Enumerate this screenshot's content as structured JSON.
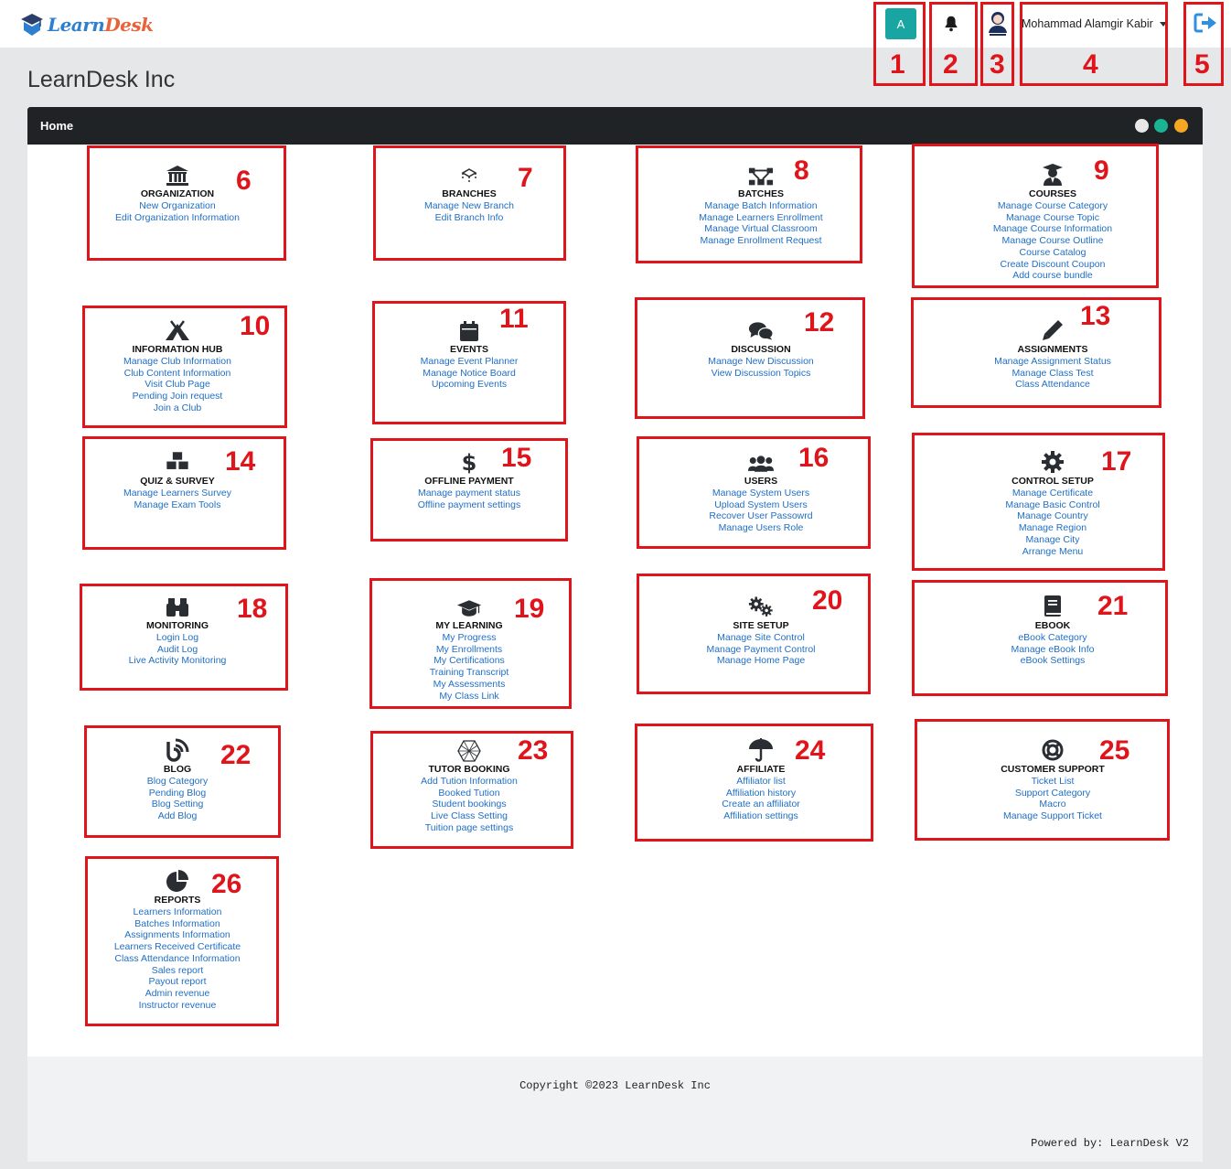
{
  "brand": {
    "name_part1": "Learn",
    "name_part2": "Desk"
  },
  "header": {
    "avatar_letter": "A",
    "user_name": "Mohammad Alamgir Kabir"
  },
  "org_title": "LearnDesk Inc",
  "panel": {
    "title": "Home"
  },
  "footer": {
    "copyright": "Copyright ©2023 LearnDesk Inc",
    "powered": "Powered by:  LearnDesk V2"
  },
  "annotation_numbers": [
    "1",
    "2",
    "3",
    "4",
    "5",
    "6",
    "7",
    "8",
    "9",
    "10",
    "11",
    "12",
    "13",
    "14",
    "15",
    "16",
    "17",
    "18",
    "19",
    "20",
    "21",
    "22",
    "23",
    "24",
    "25",
    "26"
  ],
  "annotation_color": "#e0151c",
  "link_color": "#1f6fc5",
  "cards": [
    {
      "id": "organization",
      "icon": "bank-icon",
      "title": "ORGANIZATION",
      "links": [
        "New Organization",
        "Edit Organization Information"
      ]
    },
    {
      "id": "branches",
      "icon": "branch-icon",
      "title": "BRANCHES",
      "links": [
        "Manage New Branch",
        "Edit Branch Info"
      ]
    },
    {
      "id": "batches",
      "icon": "network-icon",
      "title": "BATCHES",
      "links": [
        "Manage Batch Information",
        "Manage Learners Enrollment",
        "Manage Virtual Classroom",
        "Manage Enrollment Request"
      ]
    },
    {
      "id": "courses",
      "icon": "teacher-icon",
      "title": "COURSES",
      "links": [
        "Manage Course Category",
        "Manage Course Topic",
        "Manage Course Information",
        "Manage Course Outline",
        "Course Catalog",
        "Create Discount Coupon",
        "Add course bundle"
      ]
    },
    {
      "id": "information-hub",
      "icon": "campground-icon",
      "title": "INFORMATION HUB",
      "links": [
        "Manage Club Information",
        "Club Content Information",
        "Visit Club Page",
        "Pending Join request",
        "Join a Club"
      ]
    },
    {
      "id": "events",
      "icon": "calendar-icon",
      "title": "EVENTS",
      "links": [
        "Manage Event Planner",
        "Manage Notice Board",
        "Upcoming Events"
      ]
    },
    {
      "id": "discussion",
      "icon": "comments-icon",
      "title": "DISCUSSION",
      "links": [
        "Manage New Discussion",
        "View Discussion Topics"
      ]
    },
    {
      "id": "assignments",
      "icon": "pencil-icon",
      "title": "ASSIGNMENTS",
      "links": [
        "Manage Assignment Status",
        "Manage Class Test",
        "Class Attendance"
      ]
    },
    {
      "id": "quiz-survey",
      "icon": "cubes-icon",
      "title": "QUIZ & SURVEY",
      "links": [
        "Manage Learners Survey",
        "Manage Exam Tools"
      ]
    },
    {
      "id": "offline-payment",
      "icon": "dollar-icon",
      "title": "OFFLINE PAYMENT",
      "links": [
        "Manage payment status",
        "Offline payment settings"
      ]
    },
    {
      "id": "users",
      "icon": "users-icon",
      "title": "USERS",
      "links": [
        "Manage System Users",
        "Upload System Users",
        "Recover User Passowrd",
        "Manage Users Role"
      ]
    },
    {
      "id": "control-setup",
      "icon": "gear-icon",
      "title": "CONTROL SETUP",
      "links": [
        "Manage Certificate",
        "Manage Basic Control",
        "Manage Country",
        "Manage Region",
        "Manage City",
        "Arrange Menu"
      ]
    },
    {
      "id": "monitoring",
      "icon": "binoculars-icon",
      "title": "MONITORING",
      "links": [
        "Login Log",
        "Audit Log",
        "Live Activity Monitoring"
      ]
    },
    {
      "id": "my-learning",
      "icon": "graduation-cap-icon",
      "title": "MY LEARNING",
      "links": [
        "My Progress",
        "My Enrollments",
        "My Certifications",
        "Training Transcript",
        "My Assessments",
        "My Class Link"
      ]
    },
    {
      "id": "site-setup",
      "icon": "gears-icon",
      "title": "SITE SETUP",
      "links": [
        "Manage Site Control",
        "Manage Payment Control",
        "Manage Home Page"
      ]
    },
    {
      "id": "ebook",
      "icon": "book-icon",
      "title": "EBOOK",
      "links": [
        "eBook Category",
        "Manage eBook Info",
        "eBook Settings"
      ]
    },
    {
      "id": "blog",
      "icon": "blog-icon",
      "title": "BLOG",
      "links": [
        "Blog Category",
        "Pending Blog",
        "Blog Setting",
        "Add Blog"
      ]
    },
    {
      "id": "tutor-booking",
      "icon": "hexagon-icon",
      "title": "TUTOR BOOKING",
      "links": [
        "Add Tution Information",
        "Booked Tution",
        "Student bookings",
        "Live Class Setting",
        "Tuition page settings"
      ]
    },
    {
      "id": "affiliate",
      "icon": "umbrella-icon",
      "title": "AFFILIATE",
      "links": [
        "Affiliator list",
        "Affiliation history",
        "Create an affiliator",
        "Affiliation settings"
      ]
    },
    {
      "id": "customer-support",
      "icon": "life-ring-icon",
      "title": "CUSTOMER SUPPORT",
      "links": [
        "Ticket List",
        "Support Category",
        "Macro",
        "Manage Support Ticket"
      ]
    },
    {
      "id": "reports",
      "icon": "pie-chart-icon",
      "title": "REPORTS",
      "links": [
        "Learners Information",
        "Batches Information",
        "Assignments Information",
        "Learners Received Certificate",
        "Class Attendance Information",
        "Sales report",
        "Payout report",
        "Admin revenue",
        "Instructor revenue"
      ]
    }
  ]
}
